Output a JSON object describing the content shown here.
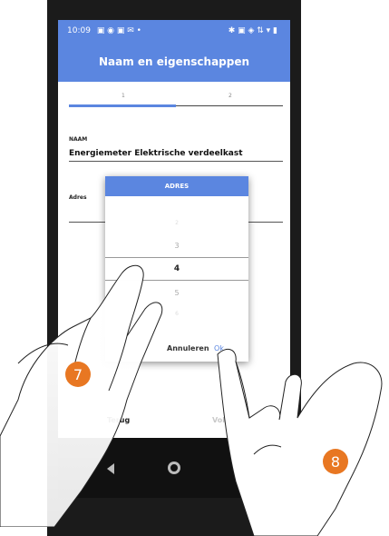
{
  "status_bar": {
    "time": "10:09"
  },
  "app_bar": {
    "title": "Naam en eigenschappen"
  },
  "steps": {
    "step1": "1",
    "step2": "2"
  },
  "form": {
    "name_label": "NAAM",
    "name_value": "Energiemeter Elektrische verdeelkast",
    "address_label": "Adres"
  },
  "dialog": {
    "title": "ADRES",
    "options": [
      "2",
      "3",
      "4",
      "5",
      "6"
    ],
    "selected": "4",
    "cancel_label": "Annuleren",
    "ok_label": "Ok"
  },
  "bottom_actions": {
    "back_label": "Terug",
    "next_label": "Volgende"
  },
  "annotations": {
    "badge_7": "7",
    "badge_8": "8"
  },
  "colors": {
    "accent": "#5b86e0",
    "badge": "#e87722"
  }
}
